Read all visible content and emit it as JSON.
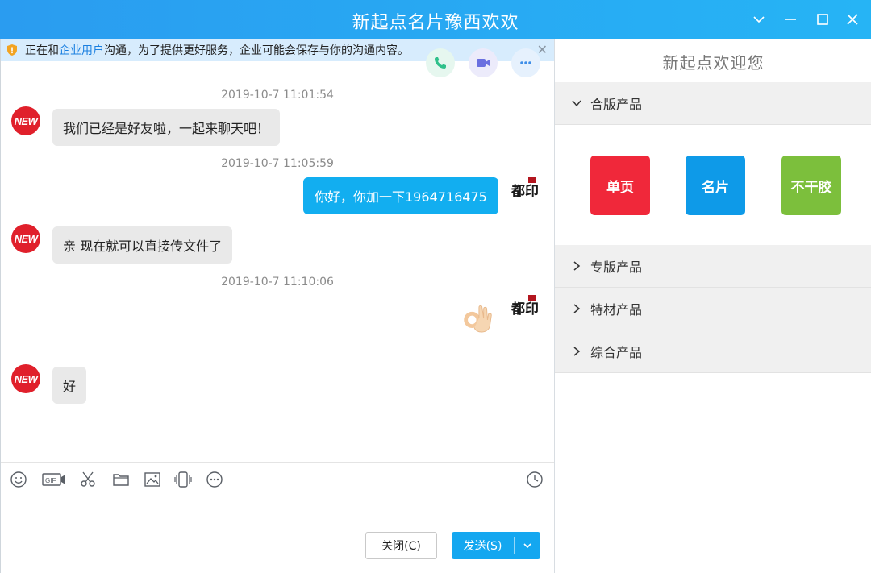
{
  "window": {
    "title": "新起点名片豫西欢欢"
  },
  "notice": {
    "prefix": "正在和",
    "link": "企业用户",
    "suffix": "沟通，为了提供更好服务，企业可能会保存与你的沟通内容。"
  },
  "messages": [
    {
      "time": "2019-10-7 11:01:54",
      "text": "我们已经是好友啦，一起来聊天吧！"
    },
    {
      "time": "2019-10-7 11:05:59",
      "text": "你好，你加一下1964716475"
    },
    {
      "text": "亲  现在就可以直接传文件了"
    },
    {
      "time": "2019-10-7 11:10:06"
    },
    {
      "text": "好"
    }
  ],
  "avatars": {
    "contact_logo": "NEW",
    "self_logo": "都印"
  },
  "composer": {
    "close_label": "关闭(C)",
    "send_label": "发送(S)"
  },
  "side": {
    "welcome": "新起点欢迎您",
    "sections": [
      {
        "label": "合版产品",
        "expanded": true
      },
      {
        "label": "专版产品",
        "expanded": false
      },
      {
        "label": "特材产品",
        "expanded": false
      },
      {
        "label": "综合产品",
        "expanded": false
      }
    ],
    "products": [
      {
        "label": "单页",
        "color": "#f0283a"
      },
      {
        "label": "名片",
        "color": "#0e9ae8"
      },
      {
        "label": "不干胶",
        "color": "#7cbf3c"
      }
    ]
  },
  "colors": {
    "titlebar": "#2aa6f2",
    "accent": "#14a7f0",
    "contact_avatar": "#e0202b"
  },
  "icons": {
    "toolbar": [
      "emoji-icon",
      "gif-icon",
      "scissors-icon",
      "folder-icon",
      "image-icon",
      "shake-icon",
      "more-icon",
      "history-clock-icon"
    ],
    "calls": [
      "phone-icon",
      "video-icon",
      "more-dots-icon"
    ]
  }
}
